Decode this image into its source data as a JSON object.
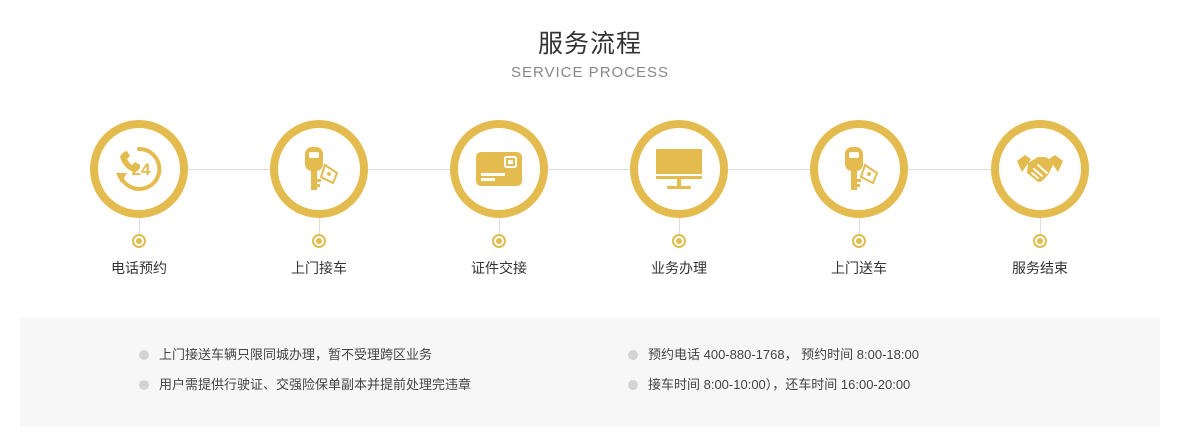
{
  "header": {
    "title": "服务流程",
    "subtitle": "SERVICE PROCESS"
  },
  "colors": {
    "accent": "#e3bb4e",
    "line": "#dcdcdc",
    "panel": "#f7f7f7"
  },
  "steps": [
    {
      "label": "电话预约",
      "icon": "phone-24-icon"
    },
    {
      "label": "上门接车",
      "icon": "car-key-icon"
    },
    {
      "label": "证件交接",
      "icon": "id-card-icon"
    },
    {
      "label": "业务办理",
      "icon": "monitor-icon"
    },
    {
      "label": "上门送车",
      "icon": "car-key-icon"
    },
    {
      "label": "服务结束",
      "icon": "handshake-icon"
    }
  ],
  "notes": {
    "left": [
      "上门接送车辆只限同城办理，暂不受理跨区业务",
      "用户需提供行驶证、交强险保单副本并提前处理完违章"
    ],
    "right": [
      "预约电话 400-880-1768，  预约时间 8:00-18:00",
      "接车时间 8:00-10:00），还车时间 16:00-20:00"
    ]
  }
}
